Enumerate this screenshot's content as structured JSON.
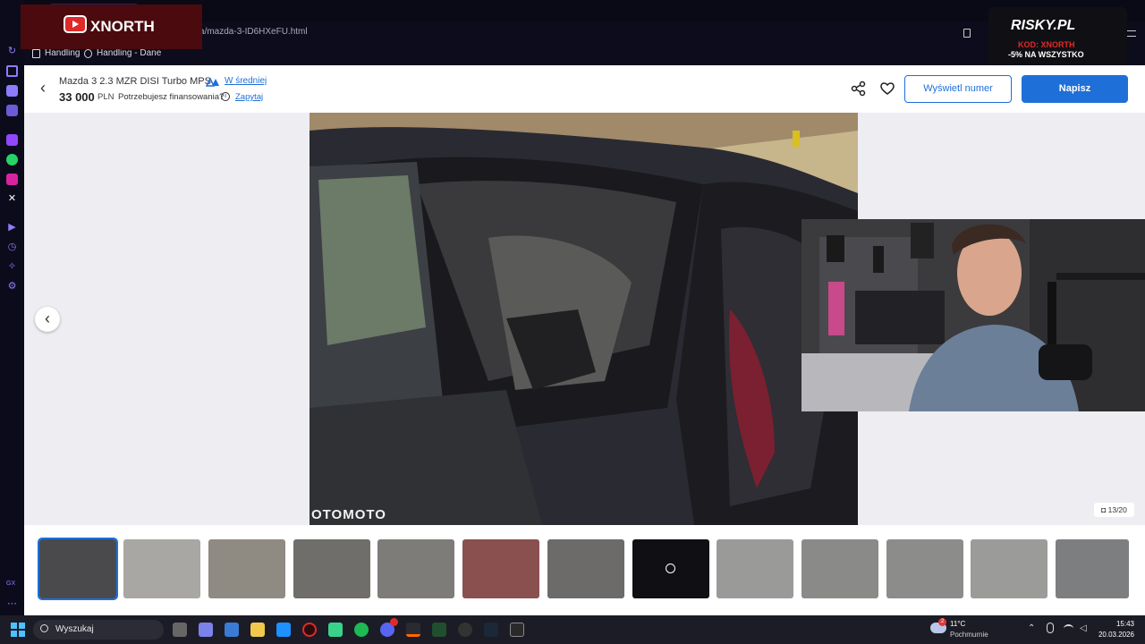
{
  "browser": {
    "url_fragment": "oferta/mazda-3-ID6HXeFU.html",
    "bookmarks": [
      "Handling",
      "Handling - Dane"
    ],
    "sidebar_label": "GX"
  },
  "listing": {
    "title": "Mazda 3 2.3 MZR DISI Turbo MPS",
    "rating_label": "W średniej",
    "price": "33 000",
    "currency": "PLN",
    "financing_question": "Potrzebujesz finansowania?",
    "ask_link": "Zapytaj",
    "show_number_label": "Wyświetl numer",
    "write_label": "Napisz"
  },
  "gallery": {
    "counter": "13/20",
    "watermark": "OTOMOTO",
    "thumbnails": [
      {
        "color": "#4a4a4c",
        "selected": true
      },
      {
        "color": "#a9a7a4"
      },
      {
        "color": "#8f8a82"
      },
      {
        "color": "#6f6e6a"
      },
      {
        "color": "#7d7c79"
      },
      {
        "color": "#8a5050"
      },
      {
        "color": "#6c6b6a"
      },
      {
        "color": "#101014",
        "is_video": true
      },
      {
        "color": "#9a9a98"
      },
      {
        "color": "#8a8a88"
      },
      {
        "color": "#8c8d8b"
      },
      {
        "color": "#9b9b99"
      },
      {
        "color": "#7d7e80"
      }
    ]
  },
  "overlays": {
    "streamer": "XNORTH",
    "sponsor": "RISKY.PL",
    "sponsor_code": "KOD: XNORTH",
    "sponsor_promo": "-5% NA WSZYSTKO"
  },
  "taskbar": {
    "search_placeholder": "Wyszukaj",
    "temperature": "11°C",
    "weather": "Pochmurnie",
    "time": "15:43",
    "date": "20.03.2026",
    "notification_count": "2"
  },
  "colors": {
    "accent_blue": "#1f6fd8",
    "gx_purple": "#8d7cff",
    "streamer_red": "#e02a2a"
  }
}
